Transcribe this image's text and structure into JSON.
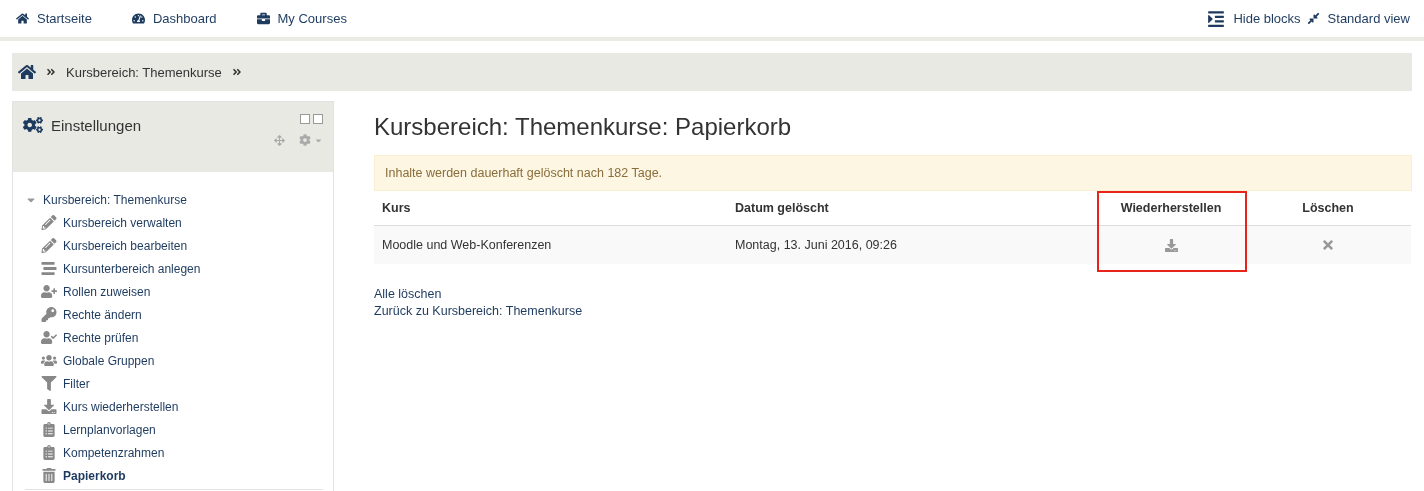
{
  "navbar": {
    "links": [
      {
        "label": "Startseite"
      },
      {
        "label": "Dashboard"
      },
      {
        "label": "My Courses"
      }
    ],
    "right_links": [
      {
        "label": "Hide blocks"
      },
      {
        "label": "Standard view"
      }
    ]
  },
  "breadcrumb": {
    "items": [
      "Kursbereich: Themenkurse"
    ]
  },
  "settings_block": {
    "title": "Einstellungen",
    "tree": [
      {
        "label": "Kursbereich: Themenkurse",
        "expanded": true,
        "children": [
          {
            "label": "Kursbereich verwalten",
            "selected": false
          },
          {
            "label": "Kursbereich bearbeiten",
            "selected": false
          },
          {
            "label": "Kursunterbereich anlegen",
            "selected": false
          },
          {
            "label": "Rollen zuweisen",
            "selected": false
          },
          {
            "label": "Rechte ändern",
            "selected": false
          },
          {
            "label": "Rechte prüfen",
            "selected": false
          },
          {
            "label": "Globale Gruppen",
            "selected": false
          },
          {
            "label": "Filter",
            "selected": false
          },
          {
            "label": "Kurs wiederherstellen",
            "selected": false
          },
          {
            "label": "Lernplanvorlagen",
            "selected": false
          },
          {
            "label": "Kompetenzrahmen",
            "selected": false
          },
          {
            "label": "Papierkorb",
            "selected": true
          }
        ]
      }
    ]
  },
  "main": {
    "heading": "Kursbereich: Themenkurse: Papierkorb",
    "notice": "Inhalte werden dauerhaft gelöscht nach 182 Tage.",
    "table": {
      "columns": [
        {
          "label": "Kurs",
          "highlighted": false
        },
        {
          "label": "Datum gelöscht",
          "highlighted": false
        },
        {
          "label": "Wiederherstellen",
          "highlighted": true
        },
        {
          "label": "Löschen",
          "highlighted": false
        }
      ],
      "rows": [
        {
          "course": "Moodle und Web-Konferenzen",
          "date": "Montag, 13. Juni 2016, 09:26"
        }
      ]
    },
    "links": [
      "Alle löschen",
      "Zurück zu Kursbereich: Themenkurse"
    ]
  }
}
